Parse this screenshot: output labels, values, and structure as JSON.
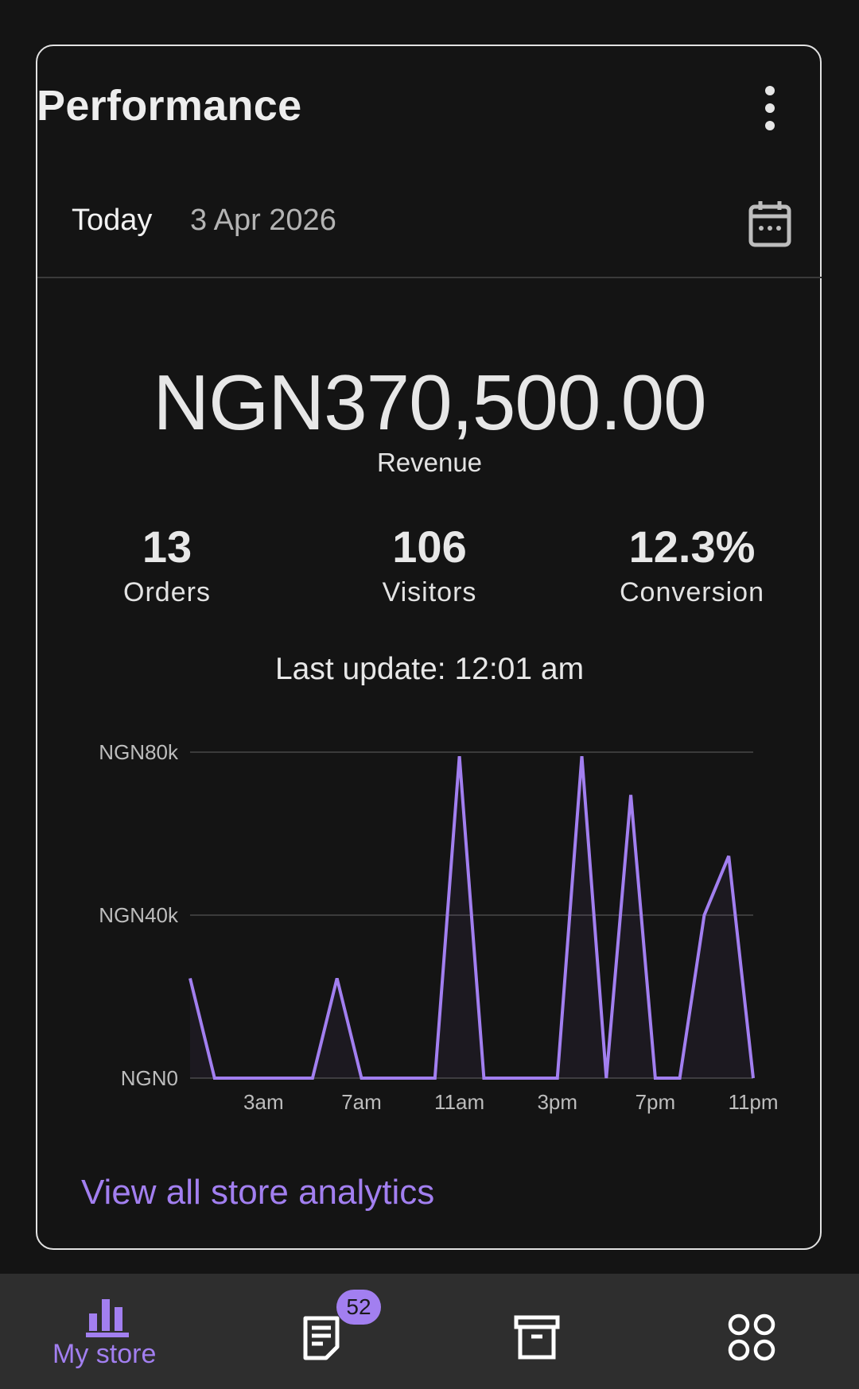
{
  "card": {
    "title": "Performance",
    "range_label": "Today",
    "date": "3 Apr 2026"
  },
  "revenue": {
    "value": "NGN370,500.00",
    "label": "Revenue"
  },
  "stats": [
    {
      "value": "13",
      "label": "Orders"
    },
    {
      "value": "106",
      "label": "Visitors"
    },
    {
      "value": "12.3%",
      "label": "Conversion"
    }
  ],
  "last_update": "Last update: 12:01 am",
  "chart_data": {
    "type": "line",
    "title": "",
    "xlabel": "",
    "ylabel": "",
    "x_tick_labels": [
      "3am",
      "7am",
      "11am",
      "3pm",
      "7pm",
      "11pm"
    ],
    "y_tick_labels": [
      "NGN0",
      "NGN40k",
      "NGN80k"
    ],
    "ylim": [
      0,
      80000
    ],
    "grid": true,
    "line_color": "#a27ff0",
    "x": [
      "0",
      "1",
      "2",
      "3",
      "4",
      "5",
      "6",
      "7",
      "8",
      "9",
      "10",
      "11",
      "12",
      "13",
      "14",
      "15",
      "16",
      "17",
      "18",
      "19",
      "20",
      "21",
      "22",
      "23"
    ],
    "values": [
      24500,
      0,
      0,
      0,
      0,
      0,
      24500,
      0,
      0,
      0,
      0,
      79000,
      0,
      0,
      0,
      0,
      79000,
      0,
      69500,
      0,
      0,
      40000,
      54500,
      0
    ]
  },
  "link": {
    "view_all": "View all store analytics"
  },
  "nav": {
    "items": [
      {
        "label": "My store",
        "icon": "bar-chart-icon",
        "active": true
      },
      {
        "label": "",
        "icon": "orders-icon",
        "badge": "52"
      },
      {
        "label": "",
        "icon": "archive-icon"
      },
      {
        "label": "",
        "icon": "apps-grid-icon"
      }
    ]
  },
  "colors": {
    "accent": "#a27ff0",
    "background": "#141414",
    "nav_bg": "#2e2e2e"
  }
}
